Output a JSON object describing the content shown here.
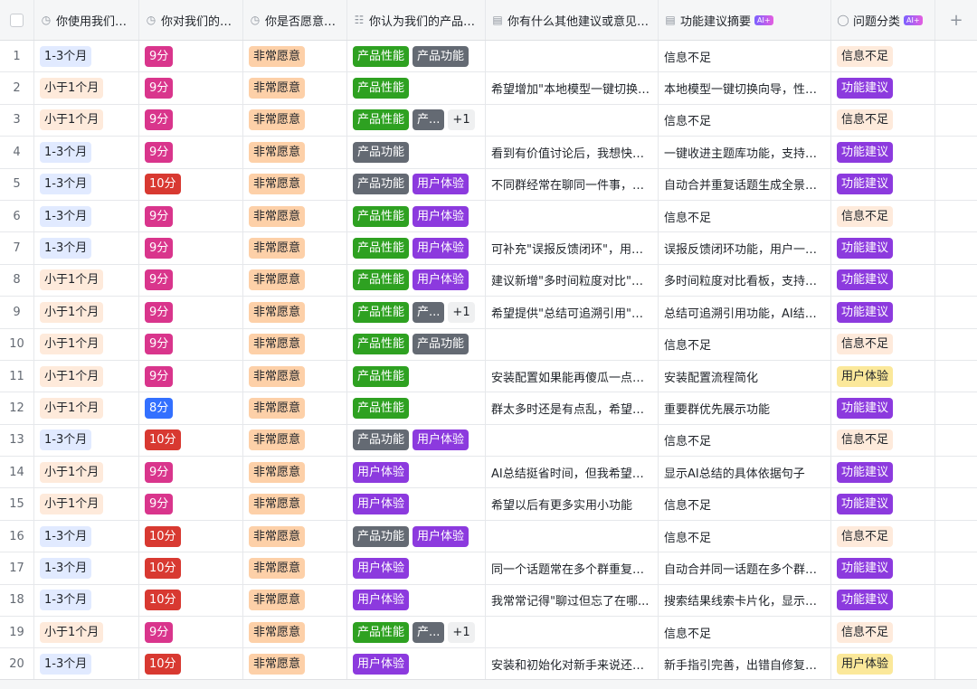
{
  "headers": [
    {
      "icon": "◷",
      "label": "你使用我们的...",
      "ai": false
    },
    {
      "icon": "◷",
      "label": "你对我们的产...",
      "ai": false
    },
    {
      "icon": "◷",
      "label": "你是否愿意向...",
      "ai": false
    },
    {
      "icon": "☷",
      "label": "你认为我们的产品需...",
      "ai": false
    },
    {
      "icon": "▤",
      "label": "你有什么其他建议或意见吗...",
      "ai": false
    },
    {
      "icon": "▤",
      "label": "功能建议摘要",
      "ai": true
    },
    {
      "icon": "◯",
      "label": "问题分类",
      "ai": true
    }
  ],
  "ai_badge_label": "AI+",
  "add_column_label": "+",
  "rows": [
    {
      "n": "1",
      "usage": "1-3个月",
      "score": "9分",
      "recommend": "非常愿意",
      "needs": [
        "产品性能",
        "产品功能"
      ],
      "more": "",
      "suggestion": "",
      "summary": "信息不足",
      "category": "信息不足"
    },
    {
      "n": "2",
      "usage": "小于1个月",
      "score": "9分",
      "recommend": "非常愿意",
      "needs": [
        "产品性能"
      ],
      "more": "",
      "suggestion": "希望增加\"本地模型一键切换\"...",
      "summary": "本地模型一键切换向导，性能...",
      "category": "功能建议"
    },
    {
      "n": "3",
      "usage": "小于1个月",
      "score": "9分",
      "recommend": "非常愿意",
      "needs": [
        "产品性能",
        "产..."
      ],
      "more": "+1",
      "suggestion": "",
      "summary": "信息不足",
      "category": "信息不足"
    },
    {
      "n": "4",
      "usage": "1-3个月",
      "score": "9分",
      "recommend": "非常愿意",
      "needs": [
        "产品功能"
      ],
      "more": "",
      "suggestion": "看到有价值讨论后，我想快速...",
      "summary": "一键收进主题库功能，支持按...",
      "category": "功能建议"
    },
    {
      "n": "5",
      "usage": "1-3个月",
      "score": "10分",
      "recommend": "非常愿意",
      "needs": [
        "产品功能",
        "用户体验"
      ],
      "more": "",
      "suggestion": "不同群经常在聊同一件事，我...",
      "summary": "自动合并重复话题生成全景总...",
      "category": "功能建议"
    },
    {
      "n": "6",
      "usage": "1-3个月",
      "score": "9分",
      "recommend": "非常愿意",
      "needs": [
        "产品性能",
        "用户体验"
      ],
      "more": "",
      "suggestion": "",
      "summary": "信息不足",
      "category": "信息不足"
    },
    {
      "n": "7",
      "usage": "1-3个月",
      "score": "9分",
      "recommend": "非常愿意",
      "needs": [
        "产品性能",
        "用户体验"
      ],
      "more": "",
      "suggestion": "可补充\"误报反馈闭环\"，用户...",
      "summary": "误报反馈闭环功能，用户一键...",
      "category": "功能建议"
    },
    {
      "n": "8",
      "usage": "小于1个月",
      "score": "9分",
      "recommend": "非常愿意",
      "needs": [
        "产品性能",
        "用户体验"
      ],
      "more": "",
      "suggestion": "建议新增\"多时间粒度对比\"看...",
      "summary": "多时间粒度对比看板，支持日...",
      "category": "功能建议"
    },
    {
      "n": "9",
      "usage": "小于1个月",
      "score": "9分",
      "recommend": "非常愿意",
      "needs": [
        "产品性能",
        "产..."
      ],
      "more": "+1",
      "suggestion": "希望提供\"总结可追溯引用\"能...",
      "summary": "总结可追溯引用功能，AI结论...",
      "category": "功能建议"
    },
    {
      "n": "10",
      "usage": "小于1个月",
      "score": "9分",
      "recommend": "非常愿意",
      "needs": [
        "产品性能",
        "产品功能"
      ],
      "more": "",
      "suggestion": "",
      "summary": "信息不足",
      "category": "信息不足"
    },
    {
      "n": "11",
      "usage": "小于1个月",
      "score": "9分",
      "recommend": "非常愿意",
      "needs": [
        "产品性能"
      ],
      "more": "",
      "suggestion": "安装配置如果能再傻瓜一点就...",
      "summary": "安装配置流程简化",
      "category": "用户体验"
    },
    {
      "n": "12",
      "usage": "小于1个月",
      "score": "8分",
      "recommend": "非常愿意",
      "needs": [
        "产品性能"
      ],
      "more": "",
      "suggestion": "群太多时还是有点乱，希望能...",
      "summary": "重要群优先展示功能",
      "category": "功能建议"
    },
    {
      "n": "13",
      "usage": "1-3个月",
      "score": "10分",
      "recommend": "非常愿意",
      "needs": [
        "产品功能",
        "用户体验"
      ],
      "more": "",
      "suggestion": "",
      "summary": "信息不足",
      "category": "信息不足"
    },
    {
      "n": "14",
      "usage": "小于1个月",
      "score": "9分",
      "recommend": "非常愿意",
      "needs": [
        "用户体验"
      ],
      "more": "",
      "suggestion": "AI总结挺省时间，但我希望能...",
      "summary": "显示AI总结的具体依据句子",
      "category": "功能建议"
    },
    {
      "n": "15",
      "usage": "小于1个月",
      "score": "9分",
      "recommend": "非常愿意",
      "needs": [
        "用户体验"
      ],
      "more": "",
      "suggestion": "希望以后有更多实用小功能",
      "summary": "信息不足",
      "category": "功能建议"
    },
    {
      "n": "16",
      "usage": "1-3个月",
      "score": "10分",
      "recommend": "非常愿意",
      "needs": [
        "产品功能",
        "用户体验"
      ],
      "more": "",
      "suggestion": "",
      "summary": "信息不足",
      "category": "信息不足"
    },
    {
      "n": "17",
      "usage": "1-3个月",
      "score": "10分",
      "recommend": "非常愿意",
      "needs": [
        "用户体验"
      ],
      "more": "",
      "suggestion": "同一个话题常在多个群重复聊...",
      "summary": "自动合并同一话题在多个群的...",
      "category": "功能建议"
    },
    {
      "n": "18",
      "usage": "1-3个月",
      "score": "10分",
      "recommend": "非常愿意",
      "needs": [
        "用户体验"
      ],
      "more": "",
      "suggestion": "我常常记得\"聊过但忘了在哪...",
      "summary": "搜索结果线索卡片化，显示时...",
      "category": "功能建议"
    },
    {
      "n": "19",
      "usage": "小于1个月",
      "score": "9分",
      "recommend": "非常愿意",
      "needs": [
        "产品性能",
        "产..."
      ],
      "more": "+1",
      "suggestion": "",
      "summary": "信息不足",
      "category": "信息不足"
    },
    {
      "n": "20",
      "usage": "1-3个月",
      "score": "10分",
      "recommend": "非常愿意",
      "needs": [
        "用户体验"
      ],
      "more": "",
      "suggestion": "安装和初始化对新手来说还是...",
      "summary": "新手指引完善，出错自修复功...",
      "category": "用户体验"
    }
  ]
}
